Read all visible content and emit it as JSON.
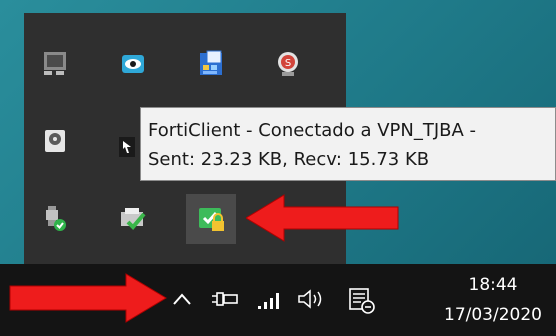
{
  "tooltip": {
    "line1": "FortiClient - Conectado a VPN_TJBA -",
    "line2": "Sent: 23.23 KB, Recv: 15.73 KB"
  },
  "clock": {
    "time": "18:44",
    "date": "17/03/2020"
  },
  "tray_icons": [
    "display-icon",
    "eye-icon",
    "calculator-icon",
    "shield-s-icon",
    "disk-icon",
    "cursor-icon",
    "usb-eject-icon",
    "print-check-icon",
    "forticlient-icon"
  ],
  "taskbar_icons": [
    "show-hidden-icons-chevron",
    "power-plug-icon",
    "signal-icon",
    "volume-icon",
    "notification-icon"
  ],
  "colors": {
    "arrow": "#ee1c1c",
    "taskbar": "#141414",
    "flyout": "#2f2f2f",
    "tooltip_bg": "#f2f2f2"
  }
}
